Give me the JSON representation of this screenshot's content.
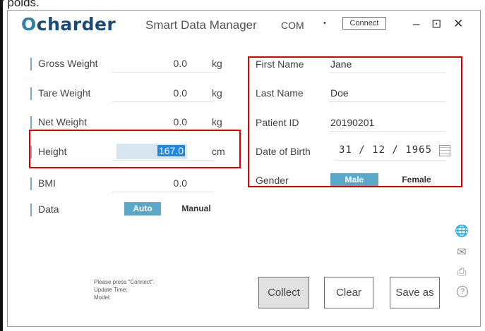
{
  "caption_fragment": "r polds.",
  "header": {
    "logo_first": "O",
    "logo_rest": "charder",
    "app_title": "Smart Data Manager",
    "com_label": "COM",
    "com_dropdown_icon": "•",
    "connect_label": "Connect",
    "window_controls": "– ⊡ ✕"
  },
  "measurements": [
    {
      "label": "Gross Weight",
      "value": "0.0",
      "unit": "kg"
    },
    {
      "label": "Tare Weight",
      "value": "0.0",
      "unit": "kg"
    },
    {
      "label": "Net Weight",
      "value": "0.0",
      "unit": "kg"
    },
    {
      "label": "Height",
      "value": "167.0",
      "unit": "cm"
    },
    {
      "label": "BMI",
      "value": "0.0",
      "unit": ""
    }
  ],
  "data_mode": {
    "label": "Data",
    "options": [
      "Auto",
      "Manual"
    ],
    "selected": "Auto"
  },
  "patient": {
    "first_name_label": "First Name",
    "first_name": "Jane",
    "last_name_label": "Last Name",
    "last_name": "Doe",
    "patient_id_label": "Patient ID",
    "patient_id": "20190201",
    "dob_label": "Date of Birth",
    "dob": "31 / 12 / 1965",
    "gender_label": "Gender",
    "gender_options": [
      "Male",
      "Female"
    ],
    "gender_selected": "Male"
  },
  "side_icons": [
    {
      "name": "globe-icon",
      "glyph": "🌐"
    },
    {
      "name": "mail-icon",
      "glyph": "✉"
    },
    {
      "name": "printer-icon",
      "glyph": "⎙"
    },
    {
      "name": "help-icon",
      "glyph": "?"
    }
  ],
  "status": {
    "message": "Please press \"Connect\".",
    "update_time_label": "Update Time:",
    "model_label": "Model:"
  },
  "actions": {
    "collect": "Collect",
    "clear": "Clear",
    "save_as": "Save as"
  },
  "colors": {
    "accent": "#5ba7c7",
    "highlight_box": "#e00000",
    "selection": "#1e88e5"
  }
}
